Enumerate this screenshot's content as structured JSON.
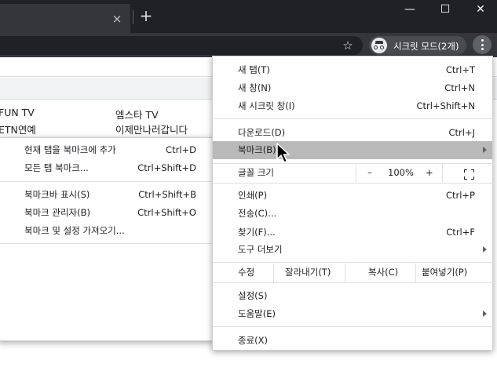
{
  "window": {
    "tab_close": "×",
    "new_tab": "+",
    "minimize": "—",
    "maximize": "☐",
    "close": "✕"
  },
  "toolbar": {
    "bookmark_star": "☆",
    "incognito_label": "시크릿 모드(2개)"
  },
  "page": {
    "rows": [
      {
        "left": "FUN TV",
        "right": "엠스타 TV"
      },
      {
        "left": "ETN연예",
        "right": "이제만나러갑니다"
      }
    ]
  },
  "main_menu": {
    "items": {
      "new_tab": {
        "label": "새 탭(T)",
        "shortcut": "Ctrl+T"
      },
      "new_window": {
        "label": "새 창(N)",
        "shortcut": "Ctrl+N"
      },
      "new_incognito": {
        "label": "새 시크릿 창(I)",
        "shortcut": "Ctrl+Shift+N"
      },
      "downloads": {
        "label": "다운로드(D)",
        "shortcut": "Ctrl+J"
      },
      "bookmarks": {
        "label": "북마크(B)"
      },
      "print": {
        "label": "인쇄(P)",
        "shortcut": "Ctrl+P"
      },
      "cast": {
        "label": "전송(C)..."
      },
      "find": {
        "label": "찾기(F)...",
        "shortcut": "Ctrl+F"
      },
      "more_tools": {
        "label": "도구 더보기"
      },
      "settings": {
        "label": "설정(S)"
      },
      "help": {
        "label": "도움말(E)"
      },
      "exit": {
        "label": "종료(X)"
      }
    },
    "zoom": {
      "label": "글꼴 크기",
      "minus": "–",
      "value": "100%",
      "plus": "+"
    },
    "edit": {
      "label": "수정",
      "cut": "잘라내기(T)",
      "copy": "복사(C)",
      "paste": "붙여넣기(P)"
    }
  },
  "bookmarks_submenu": {
    "items": [
      {
        "label": "현재 탭을 북마크에 추가",
        "shortcut": "Ctrl+D"
      },
      {
        "label": "모든 탭 북마크...",
        "shortcut": "Ctrl+Shift+D"
      },
      {
        "label": "북마크바 표시(S)",
        "shortcut": "Ctrl+Shift+B"
      },
      {
        "label": "북마크 관리자(B)",
        "shortcut": "Ctrl+Shift+O"
      },
      {
        "label": "북마크 및 설정 가져오기...",
        "shortcut": ""
      }
    ]
  },
  "colors": {
    "titlebar": "#202124",
    "toolbar": "#35363a",
    "highlight": "#b9b9b9"
  }
}
